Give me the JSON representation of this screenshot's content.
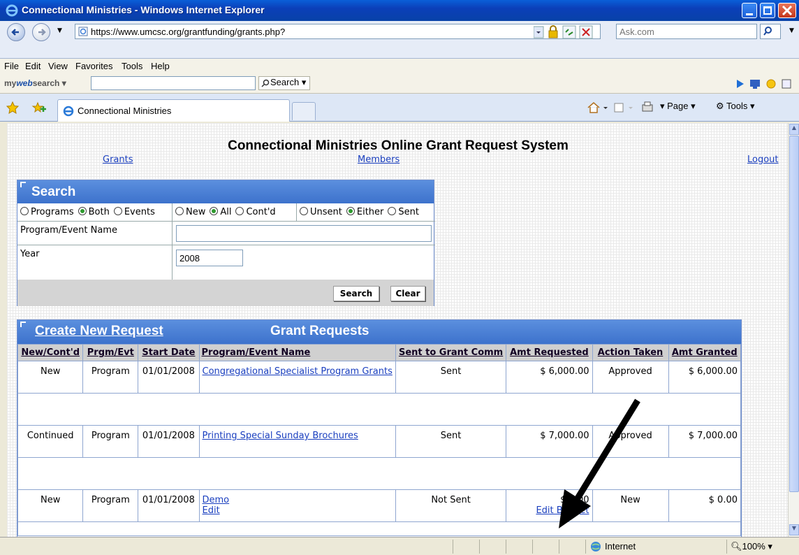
{
  "window": {
    "title": "Connectional Ministries - Windows Internet Explorer"
  },
  "address": {
    "url": "https://www.umcsc.org/grantfunding/grants.php?",
    "search_placeholder": "Ask.com"
  },
  "menu": [
    "File",
    "Edit",
    "View",
    "Favorites",
    "Tools",
    "Help"
  ],
  "toolbar": {
    "brand_prefix": "my",
    "brand_web": "web",
    "brand_suffix": "search",
    "search_label": "Search"
  },
  "tab": {
    "label": "Connectional Ministries"
  },
  "command_bar": {
    "page": "Page",
    "tools": "Tools"
  },
  "page": {
    "title": "Connectional Ministries Online Grant Request System",
    "nav": {
      "grants": "Grants",
      "members": "Members",
      "logout": "Logout"
    }
  },
  "search": {
    "header": "Search",
    "type_options": [
      "Programs",
      "Both",
      "Events"
    ],
    "status_options": [
      "New",
      "All",
      "Cont'd"
    ],
    "sent_options": [
      "Unsent",
      "Either",
      "Sent"
    ],
    "name_label": "Program/Event Name",
    "name_value": "",
    "year_label": "Year",
    "year_value": "2008",
    "search_button": "Search",
    "clear_button": "Clear"
  },
  "grants": {
    "create_link": "Create New Request",
    "header": "Grant Requests",
    "columns": [
      "New/Cont'd",
      "Prgm/Evt",
      "Start Date",
      "Program/Event Name",
      "Sent to Grant Comm",
      "Amt Requested",
      "Action Taken",
      "Amt Granted"
    ],
    "rows": [
      {
        "status": "New",
        "type": "Program",
        "start": "01/01/2008",
        "name": "Congregational Specialist Program Grants",
        "sent": "Sent",
        "requested": "$ 6,000.00",
        "action": "Approved",
        "granted": "$ 6,000.00"
      },
      {
        "status": "Continued",
        "type": "Program",
        "start": "01/01/2008",
        "name": "Printing Special Sunday Brochures",
        "sent": "Sent",
        "requested": "$ 7,000.00",
        "action": "Approved",
        "granted": "$ 7,000.00"
      },
      {
        "status": "New",
        "type": "Program",
        "start": "01/01/2008",
        "name": "Demo",
        "edit": "Edit",
        "sent": "Not Sent",
        "requested": "$ 0.00",
        "edit_budget": "Edit Budget",
        "action": "New",
        "granted": "$ 0.00"
      }
    ]
  },
  "status": {
    "zone": "Internet",
    "zoom": "100%"
  }
}
